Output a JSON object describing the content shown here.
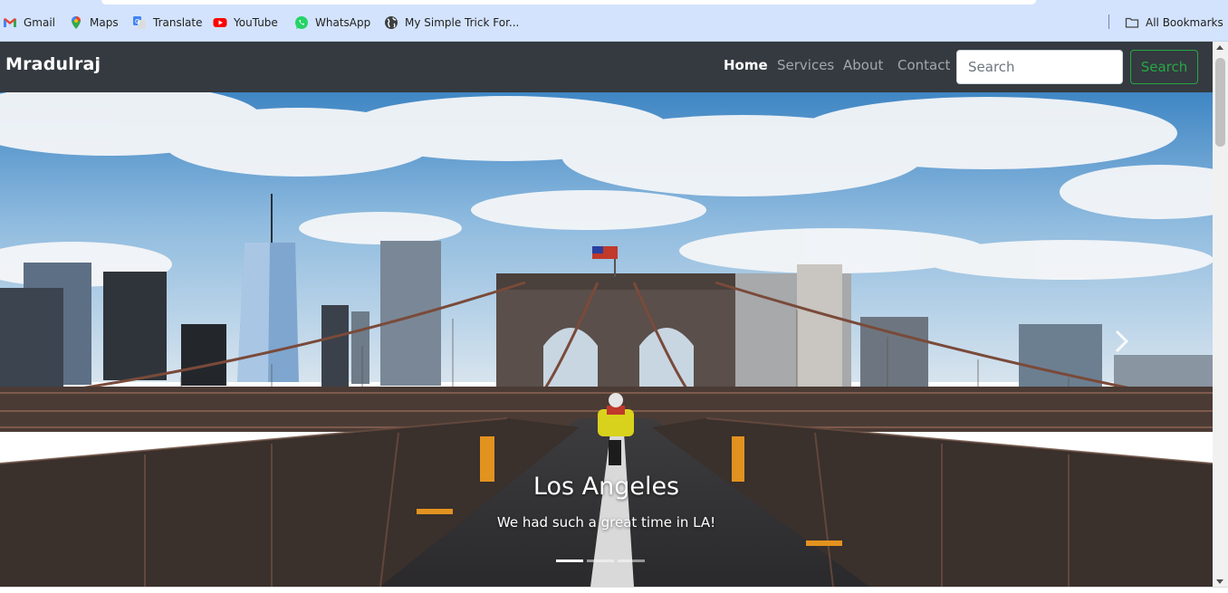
{
  "bookmarks": {
    "items": [
      {
        "label": "Gmail",
        "icon": "gmail-icon"
      },
      {
        "label": "Maps",
        "icon": "maps-icon"
      },
      {
        "label": "Translate",
        "icon": "translate-icon"
      },
      {
        "label": "YouTube",
        "icon": "youtube-icon"
      },
      {
        "label": "WhatsApp",
        "icon": "whatsapp-icon"
      },
      {
        "label": "My Simple Trick For...",
        "icon": "globe-icon"
      }
    ],
    "all_bookmarks": {
      "label": "All Bookmarks",
      "icon": "folder-icon"
    }
  },
  "navbar": {
    "brand": "Mradulraj",
    "links": [
      {
        "label": "Home",
        "active": true
      },
      {
        "label": "Services",
        "active": false
      },
      {
        "label": "About",
        "active": false
      },
      {
        "label": "Contact",
        "active": false
      }
    ],
    "search": {
      "placeholder": "Search",
      "value": ""
    },
    "search_button": "Search",
    "colors": {
      "background": "#343a40",
      "success": "#28a745"
    }
  },
  "carousel": {
    "slide": {
      "title": "Los Angeles",
      "text": "We had such a great time in LA!"
    },
    "indicators": {
      "count": 3,
      "active_index": 0
    },
    "next_icon": "chevron-right-icon"
  }
}
